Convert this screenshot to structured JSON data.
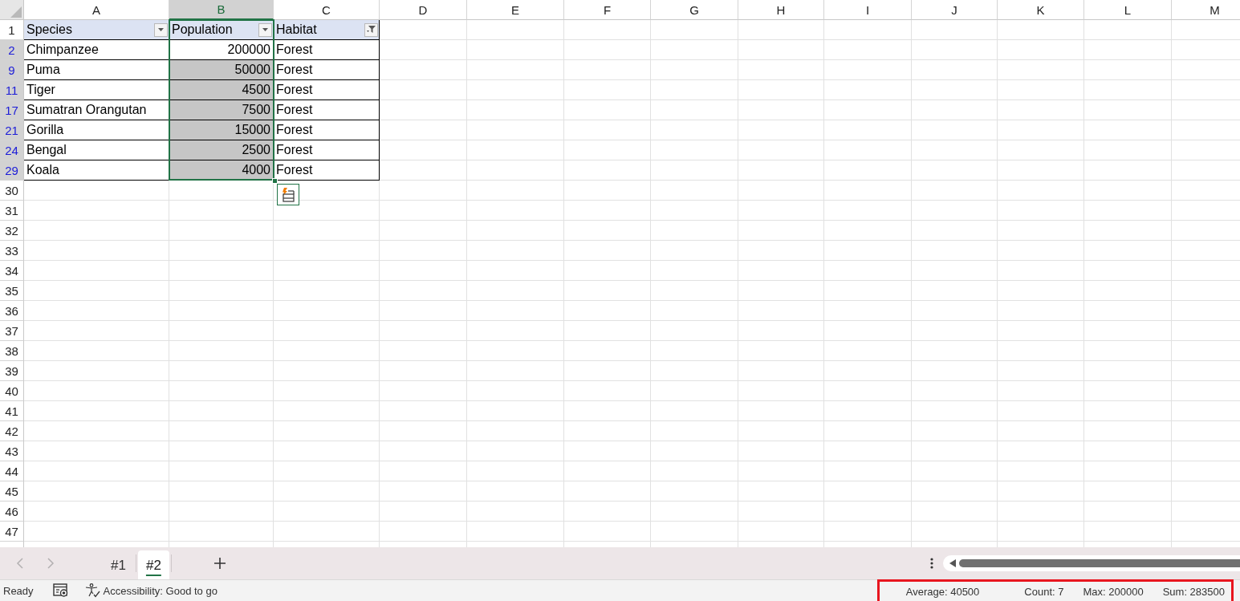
{
  "columns": [
    {
      "letter": "A",
      "selected": false
    },
    {
      "letter": "B",
      "selected": true
    },
    {
      "letter": "C",
      "selected": false
    },
    {
      "letter": "D",
      "selected": false
    },
    {
      "letter": "E",
      "selected": false
    },
    {
      "letter": "F",
      "selected": false
    },
    {
      "letter": "G",
      "selected": false
    },
    {
      "letter": "H",
      "selected": false
    },
    {
      "letter": "I",
      "selected": false
    },
    {
      "letter": "J",
      "selected": false
    },
    {
      "letter": "K",
      "selected": false
    },
    {
      "letter": "L",
      "selected": false
    },
    {
      "letter": "M",
      "selected": false
    }
  ],
  "table": {
    "header_row_number": "1",
    "header": [
      {
        "text": "Species",
        "filtered": false
      },
      {
        "text": "Population",
        "filtered": false
      },
      {
        "text": "Habitat",
        "filtered": true
      }
    ],
    "rows": [
      {
        "row_number": "2",
        "cells": [
          {
            "text": "Chimpanzee",
            "selected": false
          },
          {
            "text": "200000",
            "selected": false
          },
          {
            "text": "Forest",
            "selected": false
          }
        ]
      },
      {
        "row_number": "9",
        "cells": [
          {
            "text": "Puma",
            "selected": false
          },
          {
            "text": "50000",
            "selected": true
          },
          {
            "text": "Forest",
            "selected": false
          }
        ]
      },
      {
        "row_number": "11",
        "cells": [
          {
            "text": "Tiger",
            "selected": false
          },
          {
            "text": "4500",
            "selected": true
          },
          {
            "text": "Forest",
            "selected": false
          }
        ]
      },
      {
        "row_number": "17",
        "cells": [
          {
            "text": "Sumatran Orangutan",
            "selected": false
          },
          {
            "text": "7500",
            "selected": true
          },
          {
            "text": "Forest",
            "selected": false
          }
        ]
      },
      {
        "row_number": "21",
        "cells": [
          {
            "text": "Gorilla",
            "selected": false
          },
          {
            "text": "15000",
            "selected": true
          },
          {
            "text": "Forest",
            "selected": false
          }
        ]
      },
      {
        "row_number": "24",
        "cells": [
          {
            "text": "Bengal",
            "selected": false
          },
          {
            "text": "2500",
            "selected": true
          },
          {
            "text": "Forest",
            "selected": false
          }
        ]
      },
      {
        "row_number": "29",
        "cells": [
          {
            "text": "Koala",
            "selected": false
          },
          {
            "text": "4000",
            "selected": true
          },
          {
            "text": "Forest",
            "selected": false
          }
        ]
      }
    ]
  },
  "empty_rows": [
    "30",
    "31",
    "32",
    "33",
    "34",
    "35",
    "36",
    "37",
    "38",
    "39",
    "40",
    "41",
    "42",
    "43",
    "44",
    "45",
    "46",
    "47"
  ],
  "sheet_tabs": [
    {
      "label": "#1",
      "selected": false
    },
    {
      "label": "#2",
      "selected": true
    }
  ],
  "status_bar": {
    "mode": "Ready",
    "accessibility": "Accessibility: Good to go",
    "stats": [
      "Average: 40500",
      "Count: 7",
      "Max: 200000",
      "Sum: 283500"
    ]
  }
}
